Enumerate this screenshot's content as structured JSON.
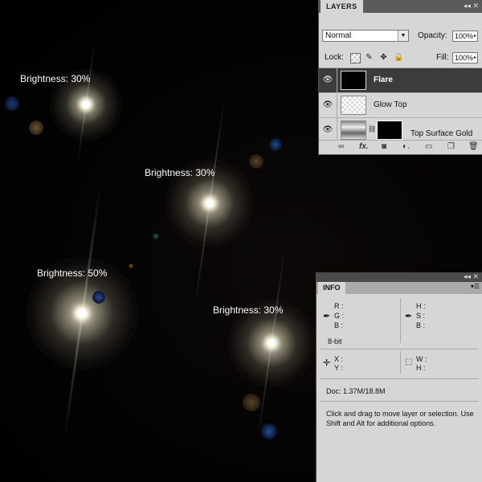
{
  "canvas": {
    "labels": [
      "Brightness: 30%",
      "Brightness: 30%",
      "Brightness: 50%",
      "Brightness: 30%"
    ]
  },
  "layers_panel": {
    "tab": "LAYERS",
    "blend_mode": "Normal",
    "opacity_label": "Opacity:",
    "opacity_value": "100%",
    "lock_label": "Lock:",
    "fill_label": "Fill:",
    "fill_value": "100%",
    "layers": [
      {
        "name": "Flare",
        "selected": true
      },
      {
        "name": "Glow Top",
        "selected": false
      },
      {
        "name": "Top Surface Gold",
        "selected": false
      }
    ],
    "footer_icons": [
      "link-icon",
      "fx-icon",
      "mask-icon",
      "adjustment-icon",
      "folder-icon",
      "new-layer-icon",
      "trash-icon"
    ]
  },
  "info_panel": {
    "tab": "INFO",
    "r": "R :",
    "g": "G :",
    "b": "B :",
    "h": "H :",
    "s": "S :",
    "b2": "B :",
    "bit_depth": "8-bit",
    "x": "X :",
    "y": "Y :",
    "w": "W :",
    "h2": "H :",
    "doc": "Doc: 1.37M/18.8M",
    "hint": "Click and drag to move layer or selection.  Use Shift and Alt for additional options."
  },
  "colors": {
    "panel_bg": "#d6d6d6",
    "selected_layer": "#3c3c3c",
    "canvas": "#000000"
  }
}
